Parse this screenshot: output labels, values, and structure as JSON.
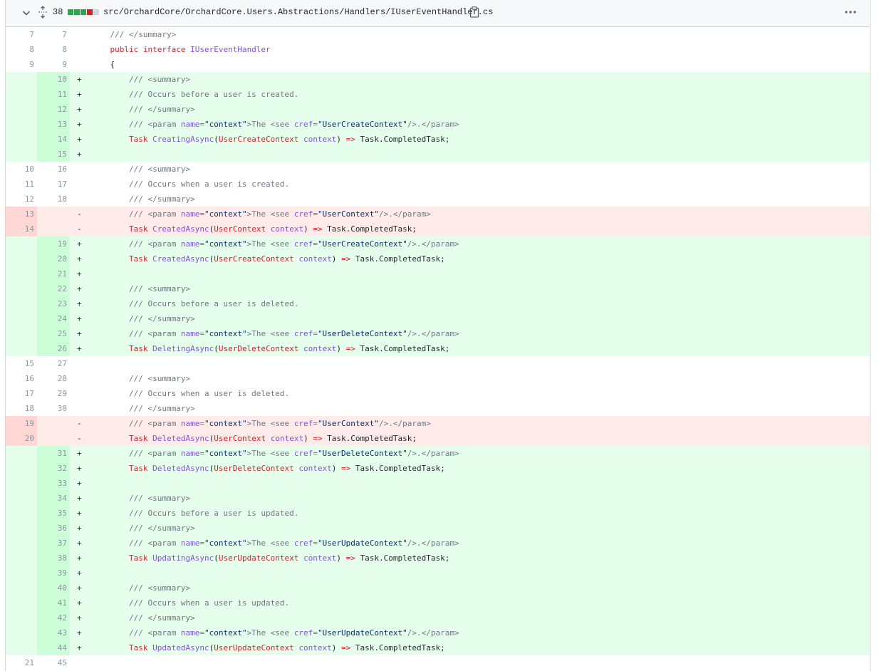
{
  "header": {
    "changes_count": "38",
    "file_path": "src/OrchardCore/OrchardCore.Users.Abstractions/Handlers/IUserEventHandler.cs",
    "diffstat_colors": [
      "#2da44e",
      "#2da44e",
      "#2da44e",
      "#cf222e",
      "#d0d7de"
    ],
    "icons": {
      "collapse": "chevron-down-icon",
      "expand": "unfold-icon",
      "copy": "copy-icon",
      "more": "kebab-horizontal-icon"
    }
  },
  "colors": {
    "added_bg": "#e6ffec",
    "added_num_bg": "#ccffd8",
    "deleted_bg": "#ffebe9",
    "deleted_num_bg": "#ffd7d5"
  },
  "lines": [
    {
      "type": "ctx",
      "old": "7",
      "new": "7",
      "marker": "",
      "tokens": [
        [
          "p",
          "    "
        ],
        [
          "c",
          "/// </summary>"
        ]
      ]
    },
    {
      "type": "ctx",
      "old": "8",
      "new": "8",
      "marker": "",
      "tokens": [
        [
          "p",
          "    "
        ],
        [
          "k",
          "public interface"
        ],
        [
          "p",
          " "
        ],
        [
          "t",
          "IUserEventHandler"
        ]
      ]
    },
    {
      "type": "ctx",
      "old": "9",
      "new": "9",
      "marker": "",
      "tokens": [
        [
          "p",
          "    {"
        ]
      ]
    },
    {
      "type": "add",
      "old": "",
      "new": "10",
      "marker": "+",
      "tokens": [
        [
          "p",
          "        "
        ],
        [
          "c",
          "/// <summary>"
        ]
      ]
    },
    {
      "type": "add",
      "old": "",
      "new": "11",
      "marker": "+",
      "tokens": [
        [
          "p",
          "        "
        ],
        [
          "c",
          "/// Occurs before a user is created."
        ]
      ]
    },
    {
      "type": "add",
      "old": "",
      "new": "12",
      "marker": "+",
      "tokens": [
        [
          "p",
          "        "
        ],
        [
          "c",
          "/// </summary>"
        ]
      ]
    },
    {
      "type": "add",
      "old": "",
      "new": "13",
      "marker": "+",
      "tokens": [
        [
          "p",
          "        "
        ],
        [
          "c",
          "/// <param "
        ],
        [
          "a",
          "name"
        ],
        [
          "c",
          "="
        ],
        [
          "s",
          "\"context\""
        ],
        [
          "c",
          ">The <see "
        ],
        [
          "a",
          "cref"
        ],
        [
          "c",
          "="
        ],
        [
          "s",
          "\"UserCreateContext\""
        ],
        [
          "c",
          "/>.</param>"
        ]
      ]
    },
    {
      "type": "add",
      "old": "",
      "new": "14",
      "marker": "+",
      "tokens": [
        [
          "p",
          "        "
        ],
        [
          "k",
          "Task"
        ],
        [
          "p",
          " "
        ],
        [
          "t",
          "CreatingAsync"
        ],
        [
          "p",
          "("
        ],
        [
          "k",
          "UserCreateContext"
        ],
        [
          "p",
          " "
        ],
        [
          "t",
          "context"
        ],
        [
          "p",
          ") "
        ],
        [
          "k",
          "=>"
        ],
        [
          "p",
          " Task.CompletedTask;"
        ]
      ]
    },
    {
      "type": "add",
      "old": "",
      "new": "15",
      "marker": "+",
      "tokens": [
        [
          "p",
          ""
        ]
      ]
    },
    {
      "type": "ctx",
      "old": "10",
      "new": "16",
      "marker": "",
      "tokens": [
        [
          "p",
          "        "
        ],
        [
          "c",
          "/// <summary>"
        ]
      ]
    },
    {
      "type": "ctx",
      "old": "11",
      "new": "17",
      "marker": "",
      "tokens": [
        [
          "p",
          "        "
        ],
        [
          "c",
          "/// Occurs when a user is created."
        ]
      ]
    },
    {
      "type": "ctx",
      "old": "12",
      "new": "18",
      "marker": "",
      "tokens": [
        [
          "p",
          "        "
        ],
        [
          "c",
          "/// </summary>"
        ]
      ]
    },
    {
      "type": "del",
      "old": "13",
      "new": "",
      "marker": "-",
      "tokens": [
        [
          "p",
          "        "
        ],
        [
          "c",
          "/// <param "
        ],
        [
          "a",
          "name"
        ],
        [
          "c",
          "="
        ],
        [
          "s",
          "\"context\""
        ],
        [
          "c",
          ">The <see "
        ],
        [
          "a",
          "cref"
        ],
        [
          "c",
          "="
        ],
        [
          "s",
          "\"UserContext\""
        ],
        [
          "c",
          "/>.</param>"
        ]
      ]
    },
    {
      "type": "del",
      "old": "14",
      "new": "",
      "marker": "-",
      "tokens": [
        [
          "p",
          "        "
        ],
        [
          "k",
          "Task"
        ],
        [
          "p",
          " "
        ],
        [
          "t",
          "CreatedAsync"
        ],
        [
          "p",
          "("
        ],
        [
          "k",
          "UserContext"
        ],
        [
          "p",
          " "
        ],
        [
          "t",
          "context"
        ],
        [
          "p",
          ") "
        ],
        [
          "k",
          "=>"
        ],
        [
          "p",
          " Task.CompletedTask;"
        ]
      ]
    },
    {
      "type": "add",
      "old": "",
      "new": "19",
      "marker": "+",
      "tokens": [
        [
          "p",
          "        "
        ],
        [
          "c",
          "/// <param "
        ],
        [
          "a",
          "name"
        ],
        [
          "c",
          "="
        ],
        [
          "s",
          "\"context\""
        ],
        [
          "c",
          ">The <see "
        ],
        [
          "a",
          "cref"
        ],
        [
          "c",
          "="
        ],
        [
          "s",
          "\"UserCreateContext\""
        ],
        [
          "c",
          "/>.</param>"
        ]
      ]
    },
    {
      "type": "add",
      "old": "",
      "new": "20",
      "marker": "+",
      "tokens": [
        [
          "p",
          "        "
        ],
        [
          "k",
          "Task"
        ],
        [
          "p",
          " "
        ],
        [
          "t",
          "CreatedAsync"
        ],
        [
          "p",
          "("
        ],
        [
          "k",
          "UserCreateContext"
        ],
        [
          "p",
          " "
        ],
        [
          "t",
          "context"
        ],
        [
          "p",
          ") "
        ],
        [
          "k",
          "=>"
        ],
        [
          "p",
          " Task.CompletedTask;"
        ]
      ]
    },
    {
      "type": "add",
      "old": "",
      "new": "21",
      "marker": "+",
      "tokens": [
        [
          "p",
          ""
        ]
      ]
    },
    {
      "type": "add",
      "old": "",
      "new": "22",
      "marker": "+",
      "tokens": [
        [
          "p",
          "        "
        ],
        [
          "c",
          "/// <summary>"
        ]
      ]
    },
    {
      "type": "add",
      "old": "",
      "new": "23",
      "marker": "+",
      "tokens": [
        [
          "p",
          "        "
        ],
        [
          "c",
          "/// Occurs before a user is deleted."
        ]
      ]
    },
    {
      "type": "add",
      "old": "",
      "new": "24",
      "marker": "+",
      "tokens": [
        [
          "p",
          "        "
        ],
        [
          "c",
          "/// </summary>"
        ]
      ]
    },
    {
      "type": "add",
      "old": "",
      "new": "25",
      "marker": "+",
      "tokens": [
        [
          "p",
          "        "
        ],
        [
          "c",
          "/// <param "
        ],
        [
          "a",
          "name"
        ],
        [
          "c",
          "="
        ],
        [
          "s",
          "\"context\""
        ],
        [
          "c",
          ">The <see "
        ],
        [
          "a",
          "cref"
        ],
        [
          "c",
          "="
        ],
        [
          "s",
          "\"UserDeleteContext\""
        ],
        [
          "c",
          "/>.</param>"
        ]
      ]
    },
    {
      "type": "add",
      "old": "",
      "new": "26",
      "marker": "+",
      "tokens": [
        [
          "p",
          "        "
        ],
        [
          "k",
          "Task"
        ],
        [
          "p",
          " "
        ],
        [
          "t",
          "DeletingAsync"
        ],
        [
          "p",
          "("
        ],
        [
          "k",
          "UserDeleteContext"
        ],
        [
          "p",
          " "
        ],
        [
          "t",
          "context"
        ],
        [
          "p",
          ") "
        ],
        [
          "k",
          "=>"
        ],
        [
          "p",
          " Task.CompletedTask;"
        ]
      ]
    },
    {
      "type": "ctx",
      "old": "15",
      "new": "27",
      "marker": "",
      "tokens": [
        [
          "p",
          ""
        ]
      ]
    },
    {
      "type": "ctx",
      "old": "16",
      "new": "28",
      "marker": "",
      "tokens": [
        [
          "p",
          "        "
        ],
        [
          "c",
          "/// <summary>"
        ]
      ]
    },
    {
      "type": "ctx",
      "old": "17",
      "new": "29",
      "marker": "",
      "tokens": [
        [
          "p",
          "        "
        ],
        [
          "c",
          "/// Occurs when a user is deleted."
        ]
      ]
    },
    {
      "type": "ctx",
      "old": "18",
      "new": "30",
      "marker": "",
      "tokens": [
        [
          "p",
          "        "
        ],
        [
          "c",
          "/// </summary>"
        ]
      ]
    },
    {
      "type": "del",
      "old": "19",
      "new": "",
      "marker": "-",
      "tokens": [
        [
          "p",
          "        "
        ],
        [
          "c",
          "/// <param "
        ],
        [
          "a",
          "name"
        ],
        [
          "c",
          "="
        ],
        [
          "s",
          "\"context\""
        ],
        [
          "c",
          ">The <see "
        ],
        [
          "a",
          "cref"
        ],
        [
          "c",
          "="
        ],
        [
          "s",
          "\"UserContext\""
        ],
        [
          "c",
          "/>.</param>"
        ]
      ]
    },
    {
      "type": "del",
      "old": "20",
      "new": "",
      "marker": "-",
      "tokens": [
        [
          "p",
          "        "
        ],
        [
          "k",
          "Task"
        ],
        [
          "p",
          " "
        ],
        [
          "t",
          "DeletedAsync"
        ],
        [
          "p",
          "("
        ],
        [
          "k",
          "UserContext"
        ],
        [
          "p",
          " "
        ],
        [
          "t",
          "context"
        ],
        [
          "p",
          ") "
        ],
        [
          "k",
          "=>"
        ],
        [
          "p",
          " Task.CompletedTask;"
        ]
      ]
    },
    {
      "type": "add",
      "old": "",
      "new": "31",
      "marker": "+",
      "tokens": [
        [
          "p",
          "        "
        ],
        [
          "c",
          "/// <param "
        ],
        [
          "a",
          "name"
        ],
        [
          "c",
          "="
        ],
        [
          "s",
          "\"context\""
        ],
        [
          "c",
          ">The <see "
        ],
        [
          "a",
          "cref"
        ],
        [
          "c",
          "="
        ],
        [
          "s",
          "\"UserDeleteContext\""
        ],
        [
          "c",
          "/>.</param>"
        ]
      ]
    },
    {
      "type": "add",
      "old": "",
      "new": "32",
      "marker": "+",
      "tokens": [
        [
          "p",
          "        "
        ],
        [
          "k",
          "Task"
        ],
        [
          "p",
          " "
        ],
        [
          "t",
          "DeletedAsync"
        ],
        [
          "p",
          "("
        ],
        [
          "k",
          "UserDeleteContext"
        ],
        [
          "p",
          " "
        ],
        [
          "t",
          "context"
        ],
        [
          "p",
          ") "
        ],
        [
          "k",
          "=>"
        ],
        [
          "p",
          " Task.CompletedTask;"
        ]
      ]
    },
    {
      "type": "add",
      "old": "",
      "new": "33",
      "marker": "+",
      "tokens": [
        [
          "p",
          ""
        ]
      ]
    },
    {
      "type": "add",
      "old": "",
      "new": "34",
      "marker": "+",
      "tokens": [
        [
          "p",
          "        "
        ],
        [
          "c",
          "/// <summary>"
        ]
      ]
    },
    {
      "type": "add",
      "old": "",
      "new": "35",
      "marker": "+",
      "tokens": [
        [
          "p",
          "        "
        ],
        [
          "c",
          "/// Occurs before a user is updated."
        ]
      ]
    },
    {
      "type": "add",
      "old": "",
      "new": "36",
      "marker": "+",
      "tokens": [
        [
          "p",
          "        "
        ],
        [
          "c",
          "/// </summary>"
        ]
      ]
    },
    {
      "type": "add",
      "old": "",
      "new": "37",
      "marker": "+",
      "tokens": [
        [
          "p",
          "        "
        ],
        [
          "c",
          "/// <param "
        ],
        [
          "a",
          "name"
        ],
        [
          "c",
          "="
        ],
        [
          "s",
          "\"context\""
        ],
        [
          "c",
          ">The <see "
        ],
        [
          "a",
          "cref"
        ],
        [
          "c",
          "="
        ],
        [
          "s",
          "\"UserUpdateContext\""
        ],
        [
          "c",
          "/>.</param>"
        ]
      ]
    },
    {
      "type": "add",
      "old": "",
      "new": "38",
      "marker": "+",
      "tokens": [
        [
          "p",
          "        "
        ],
        [
          "k",
          "Task"
        ],
        [
          "p",
          " "
        ],
        [
          "t",
          "UpdatingAsync"
        ],
        [
          "p",
          "("
        ],
        [
          "k",
          "UserUpdateContext"
        ],
        [
          "p",
          " "
        ],
        [
          "t",
          "context"
        ],
        [
          "p",
          ") "
        ],
        [
          "k",
          "=>"
        ],
        [
          "p",
          " Task.CompletedTask;"
        ]
      ]
    },
    {
      "type": "add",
      "old": "",
      "new": "39",
      "marker": "+",
      "tokens": [
        [
          "p",
          ""
        ]
      ]
    },
    {
      "type": "add",
      "old": "",
      "new": "40",
      "marker": "+",
      "tokens": [
        [
          "p",
          "        "
        ],
        [
          "c",
          "/// <summary>"
        ]
      ]
    },
    {
      "type": "add",
      "old": "",
      "new": "41",
      "marker": "+",
      "tokens": [
        [
          "p",
          "        "
        ],
        [
          "c",
          "/// Occurs when a user is updated."
        ]
      ]
    },
    {
      "type": "add",
      "old": "",
      "new": "42",
      "marker": "+",
      "tokens": [
        [
          "p",
          "        "
        ],
        [
          "c",
          "/// </summary>"
        ]
      ]
    },
    {
      "type": "add",
      "old": "",
      "new": "43",
      "marker": "+",
      "tokens": [
        [
          "p",
          "        "
        ],
        [
          "c",
          "/// <param "
        ],
        [
          "a",
          "name"
        ],
        [
          "c",
          "="
        ],
        [
          "s",
          "\"context\""
        ],
        [
          "c",
          ">The <see "
        ],
        [
          "a",
          "cref"
        ],
        [
          "c",
          "="
        ],
        [
          "s",
          "\"UserUpdateContext\""
        ],
        [
          "c",
          "/>.</param>"
        ]
      ]
    },
    {
      "type": "add",
      "old": "",
      "new": "44",
      "marker": "+",
      "tokens": [
        [
          "p",
          "        "
        ],
        [
          "k",
          "Task"
        ],
        [
          "p",
          " "
        ],
        [
          "t",
          "UpdatedAsync"
        ],
        [
          "p",
          "("
        ],
        [
          "k",
          "UserUpdateContext"
        ],
        [
          "p",
          " "
        ],
        [
          "t",
          "context"
        ],
        [
          "p",
          ") "
        ],
        [
          "k",
          "=>"
        ],
        [
          "p",
          " Task.CompletedTask;"
        ]
      ]
    },
    {
      "type": "ctx",
      "old": "21",
      "new": "45",
      "marker": "",
      "tokens": [
        [
          "p",
          ""
        ]
      ]
    }
  ]
}
